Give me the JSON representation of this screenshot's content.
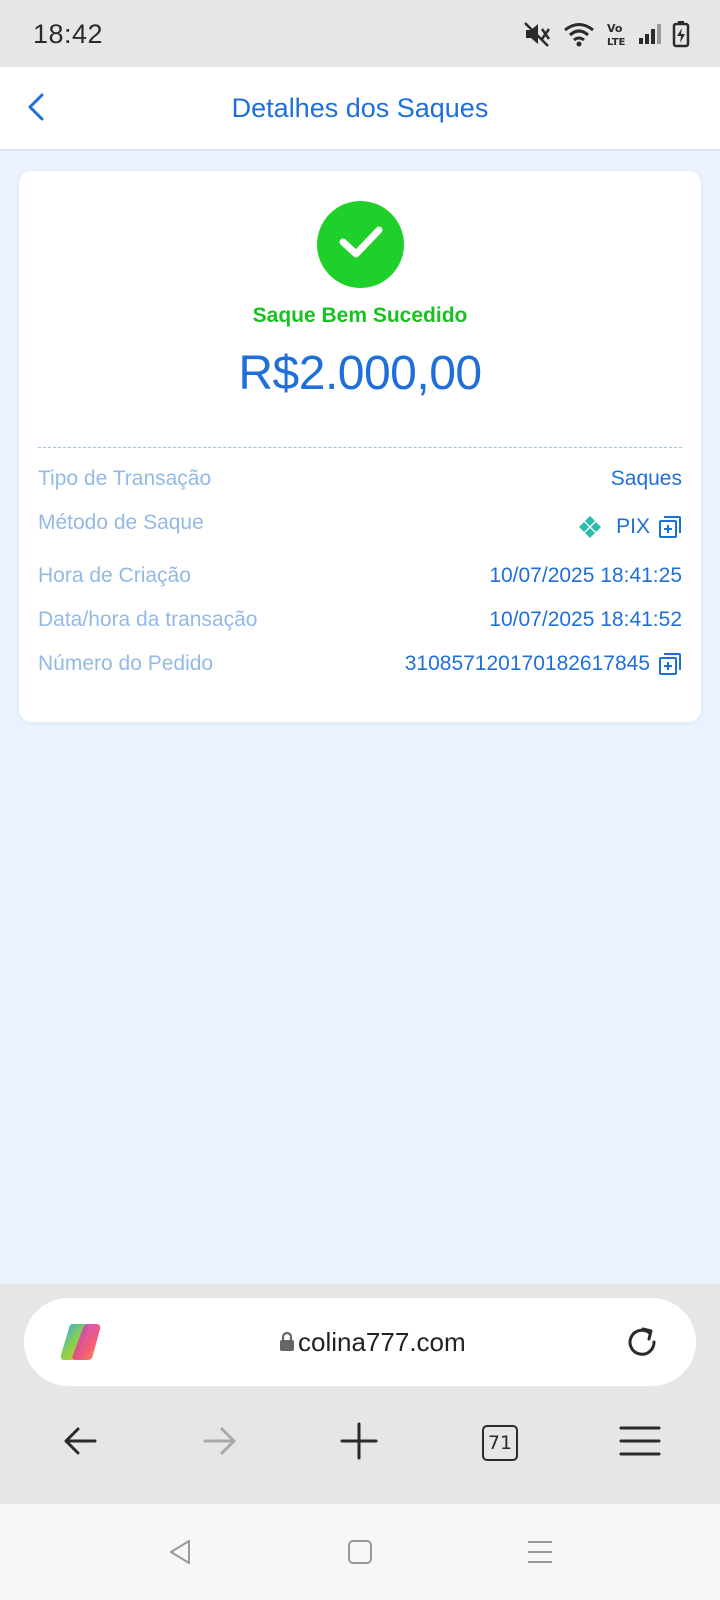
{
  "status_bar": {
    "time": "18:42",
    "icons": [
      "mute-icon",
      "wifi-icon",
      "volte-icon",
      "signal-icon",
      "battery-charging-icon"
    ]
  },
  "header": {
    "title": "Detalhes dos Saques",
    "back_icon": "chevron-left-icon"
  },
  "summary": {
    "status_text": "Saque Bem Sucedido",
    "amount": "R$2.000,00",
    "status_icon": "checkmark-icon",
    "status_color": "#1fcf2a"
  },
  "details": [
    {
      "label": "Tipo de Transação",
      "value": "Saques"
    },
    {
      "label": "Método de Saque",
      "value": "PIX",
      "icon": "pix-icon",
      "copy": true
    },
    {
      "label": "Hora de Criação",
      "value": "10/07/2025 18:41:25"
    },
    {
      "label": "Data/hora da transação",
      "value": "10/07/2025 18:41:52"
    },
    {
      "label": "Número do Pedido",
      "value": "310857120170182617845",
      "copy": true
    }
  ],
  "browser": {
    "url": "colina777.com",
    "tab_count": "71",
    "icons": [
      "copilot-icon",
      "lock-icon",
      "reload-icon",
      "back-arrow-icon",
      "forward-arrow-icon",
      "plus-icon",
      "tabs-icon",
      "menu-icon"
    ]
  },
  "system_nav": {
    "icons": [
      "back-triangle-icon",
      "home-square-icon",
      "recents-icon"
    ]
  },
  "colors": {
    "accent": "#1e6fd9",
    "label": "#93b9e6",
    "success": "#17c21f",
    "page_bg": "#eaf2fd"
  }
}
